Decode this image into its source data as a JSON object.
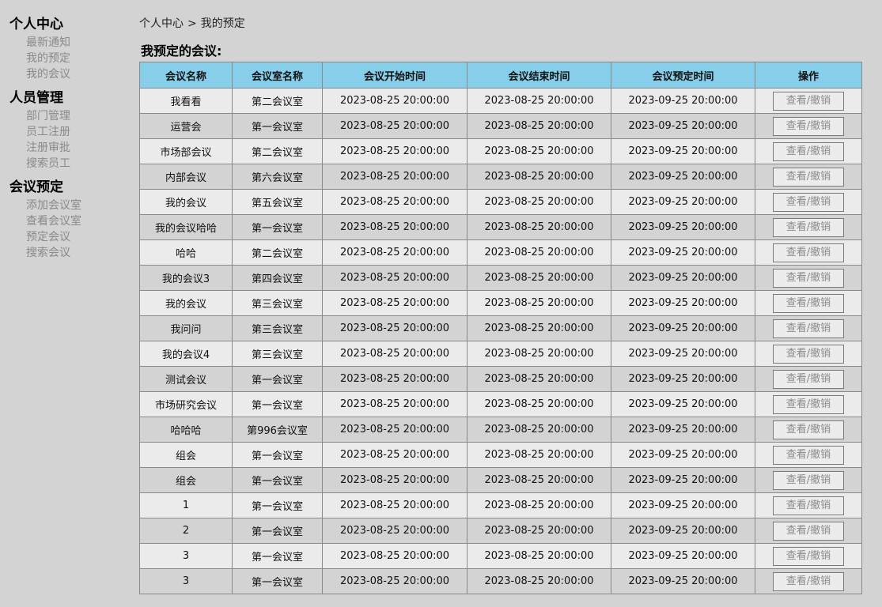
{
  "sidebar": {
    "groups": [
      {
        "title": "个人中心",
        "items": [
          "最新通知",
          "我的预定",
          "我的会议"
        ]
      },
      {
        "title": "人员管理",
        "items": [
          "部门管理",
          "员工注册",
          "注册审批",
          "搜索员工"
        ]
      },
      {
        "title": "会议预定",
        "items": [
          "添加会议室",
          "查看会议室",
          "预定会议",
          "搜索会议"
        ]
      }
    ]
  },
  "breadcrumb": {
    "home": "个人中心",
    "separator": ">",
    "current": "我的预定"
  },
  "section_title": "我预定的会议:",
  "table": {
    "headers": [
      "会议名称",
      "会议室名称",
      "会议开始时间",
      "会议结束时间",
      "会议预定时间",
      "操作"
    ],
    "action_label": "查看/撤销",
    "rows": [
      [
        "我看看",
        "第二会议室",
        "2023-08-25 20:00:00",
        "2023-08-25 20:00:00",
        "2023-09-25 20:00:00"
      ],
      [
        "运营会",
        "第一会议室",
        "2023-08-25 20:00:00",
        "2023-08-25 20:00:00",
        "2023-09-25 20:00:00"
      ],
      [
        "市场部会议",
        "第二会议室",
        "2023-08-25 20:00:00",
        "2023-08-25 20:00:00",
        "2023-09-25 20:00:00"
      ],
      [
        "内部会议",
        "第六会议室",
        "2023-08-25 20:00:00",
        "2023-08-25 20:00:00",
        "2023-09-25 20:00:00"
      ],
      [
        "我的会议",
        "第五会议室",
        "2023-08-25 20:00:00",
        "2023-08-25 20:00:00",
        "2023-09-25 20:00:00"
      ],
      [
        "我的会议哈哈",
        "第一会议室",
        "2023-08-25 20:00:00",
        "2023-08-25 20:00:00",
        "2023-09-25 20:00:00"
      ],
      [
        "哈哈",
        "第二会议室",
        "2023-08-25 20:00:00",
        "2023-08-25 20:00:00",
        "2023-09-25 20:00:00"
      ],
      [
        "我的会议3",
        "第四会议室",
        "2023-08-25 20:00:00",
        "2023-08-25 20:00:00",
        "2023-09-25 20:00:00"
      ],
      [
        "我的会议",
        "第三会议室",
        "2023-08-25 20:00:00",
        "2023-08-25 20:00:00",
        "2023-09-25 20:00:00"
      ],
      [
        "我问问",
        "第三会议室",
        "2023-08-25 20:00:00",
        "2023-08-25 20:00:00",
        "2023-09-25 20:00:00"
      ],
      [
        "我的会议4",
        "第三会议室",
        "2023-08-25 20:00:00",
        "2023-08-25 20:00:00",
        "2023-09-25 20:00:00"
      ],
      [
        "测试会议",
        "第一会议室",
        "2023-08-25 20:00:00",
        "2023-08-25 20:00:00",
        "2023-09-25 20:00:00"
      ],
      [
        "市场研究会议",
        "第一会议室",
        "2023-08-25 20:00:00",
        "2023-08-25 20:00:00",
        "2023-09-25 20:00:00"
      ],
      [
        "哈哈哈",
        "第996会议室",
        "2023-08-25 20:00:00",
        "2023-08-25 20:00:00",
        "2023-09-25 20:00:00"
      ],
      [
        "组会",
        "第一会议室",
        "2023-08-25 20:00:00",
        "2023-08-25 20:00:00",
        "2023-09-25 20:00:00"
      ],
      [
        "组会",
        "第一会议室",
        "2023-08-25 20:00:00",
        "2023-08-25 20:00:00",
        "2023-09-25 20:00:00"
      ],
      [
        "1",
        "第一会议室",
        "2023-08-25 20:00:00",
        "2023-08-25 20:00:00",
        "2023-09-25 20:00:00"
      ],
      [
        "2",
        "第一会议室",
        "2023-08-25 20:00:00",
        "2023-08-25 20:00:00",
        "2023-09-25 20:00:00"
      ],
      [
        "3",
        "第一会议室",
        "2023-08-25 20:00:00",
        "2023-08-25 20:00:00",
        "2023-09-25 20:00:00"
      ],
      [
        "3",
        "第一会议室",
        "2023-08-25 20:00:00",
        "2023-08-25 20:00:00",
        "2023-09-25 20:00:00"
      ]
    ]
  },
  "colors": {
    "page_background": "#d3d3d3",
    "header_background": "#87ceeb",
    "row_light": "#ebebeb",
    "row_dark": "#d3d3d3",
    "nav_link": "#8a8a8a"
  }
}
